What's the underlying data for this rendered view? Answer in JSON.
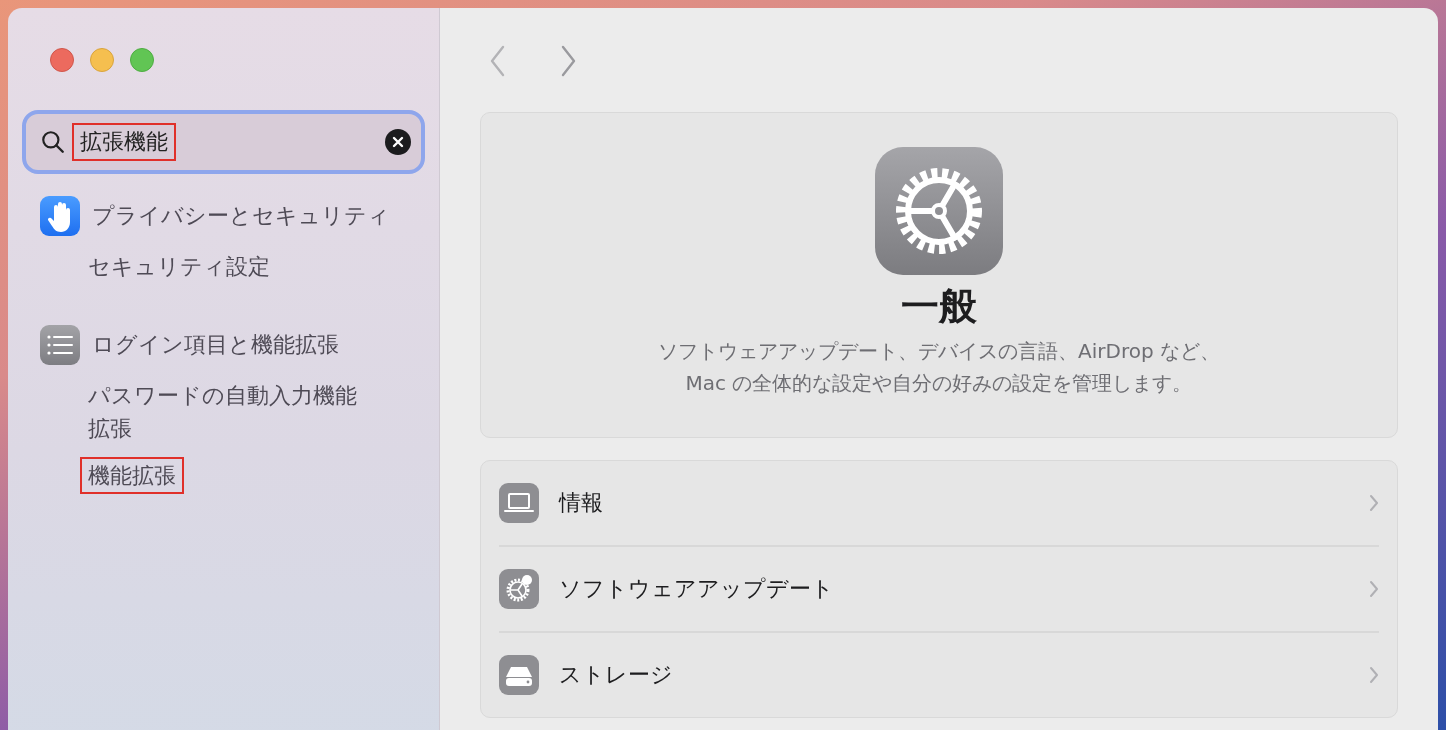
{
  "sidebar": {
    "search": {
      "value": "拡張機能",
      "highlighted": true
    },
    "results": [
      {
        "title": "プライバシーとセキュリティ",
        "kind": "privacy",
        "children": [
          {
            "label": "セキュリティ設定",
            "highlighted": false
          }
        ]
      },
      {
        "title": "ログイン項目と機能拡張",
        "kind": "list",
        "children": [
          {
            "label": "パスワードの自動入力機能拡張",
            "highlighted": false
          },
          {
            "label": "機能拡張",
            "highlighted": true
          }
        ]
      }
    ]
  },
  "main": {
    "header": {
      "title": "一般",
      "description": [
        "ソフトウェアアップデート、デバイスの言語、AirDrop など、",
        "Mac の全体的な設定や自分の好みの設定を管理します。"
      ]
    },
    "rows": [
      {
        "label": "情報",
        "kind": "laptop"
      },
      {
        "label": "ソフトウェアアップデート",
        "kind": "update"
      },
      {
        "label": "ストレージ",
        "kind": "drive"
      }
    ]
  }
}
